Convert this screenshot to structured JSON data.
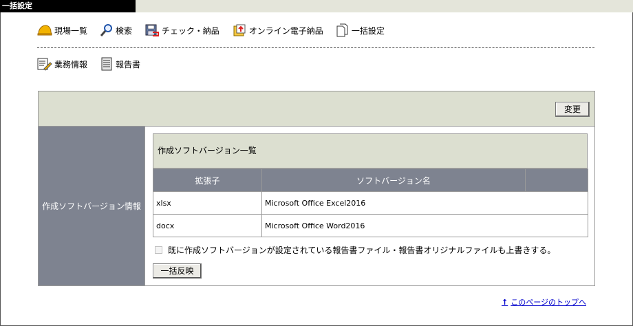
{
  "window": {
    "title": "一括設定"
  },
  "nav_primary": [
    {
      "label": "現場一覧",
      "icon": "helmet-icon"
    },
    {
      "label": "検索",
      "icon": "magnifier-icon"
    },
    {
      "label": "チェック・納品",
      "icon": "save-disk-icon"
    },
    {
      "label": "オンライン電子納品",
      "icon": "online-delivery-icon"
    },
    {
      "label": "一括設定",
      "icon": "documents-icon"
    }
  ],
  "nav_secondary": [
    {
      "label": "業務情報",
      "icon": "edit-document-icon"
    },
    {
      "label": "報告書",
      "icon": "report-icon"
    }
  ],
  "panel": {
    "change_button": "変更",
    "side_label": "作成ソフトバージョン情報",
    "section_title": "作成ソフトバージョン一覧",
    "table": {
      "columns": [
        "拡張子",
        "ソフトバージョン名",
        ""
      ],
      "rows": [
        {
          "ext": "xlsx",
          "name": "Microsoft Office Excel2016"
        },
        {
          "ext": "docx",
          "name": "Microsoft Office Word2016"
        }
      ]
    },
    "overwrite_checkbox": {
      "label": "既に作成ソフトバージョンが設定されている報告書ファイル・報告書オリジナルファイルも上書きする。",
      "checked": false
    },
    "apply_button": "一括反映"
  },
  "footer": {
    "top_link": "このページのトップへ"
  },
  "colors": {
    "header_bg": "#dcdfd0",
    "label_bg": "#7e8390",
    "link": "#0000cc"
  }
}
